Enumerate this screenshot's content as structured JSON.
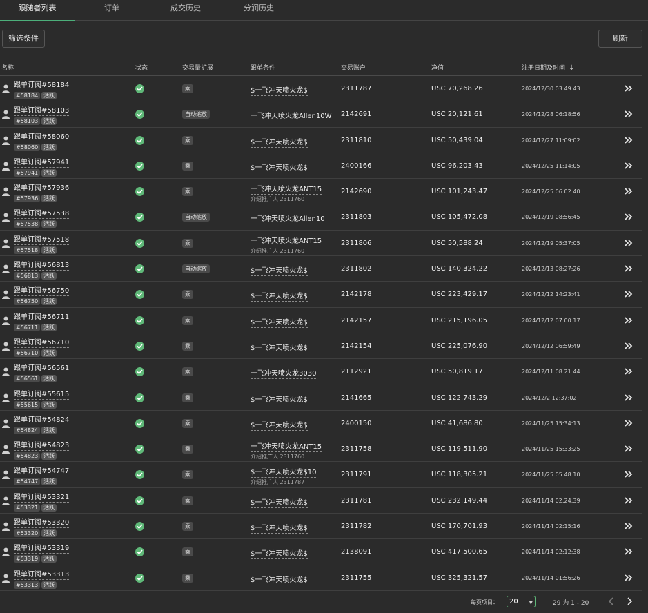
{
  "tabs": [
    {
      "label": "跟随者列表",
      "active": true
    },
    {
      "label": "订单",
      "active": false
    },
    {
      "label": "成交历史",
      "active": false
    },
    {
      "label": "分润历史",
      "active": false
    }
  ],
  "toolbar": {
    "filter_label": "筛选条件",
    "refresh_label": "刷新"
  },
  "columns": {
    "name": "名称",
    "status": "状态",
    "volume_scale": "交易量扩展",
    "copy_condition": "跟单条件",
    "account": "交易账户",
    "equity": "净值",
    "register_time": "注册日期及时间",
    "sort_icon": "arrow-down-icon"
  },
  "colors": {
    "accent": "#4caf7a",
    "status_ok": "#5fb878"
  },
  "rows": [
    {
      "name": "跟单订阅#58184",
      "id": "#58184",
      "badge": "活跃",
      "scale": "乘",
      "cond": "$一飞冲天喷火龙$",
      "sub": "",
      "account": "2311787",
      "equity": "USC 70,268.26",
      "date": "2024/12/30 03:49:43"
    },
    {
      "name": "跟单订阅#58103",
      "id": "#58103",
      "badge": "活跃",
      "scale": "自动缩放",
      "cond": "一飞冲天喷火龙Allen10W",
      "sub": "",
      "account": "2142691",
      "equity": "USC 20,121.61",
      "date": "2024/12/28 06:18:56"
    },
    {
      "name": "跟单订阅#58060",
      "id": "#58060",
      "badge": "活跃",
      "scale": "乘",
      "cond": "$一飞冲天喷火龙$",
      "sub": "",
      "account": "2311810",
      "equity": "USC 50,439.04",
      "date": "2024/12/27 11:09:02"
    },
    {
      "name": "跟单订阅#57941",
      "id": "#57941",
      "badge": "活跃",
      "scale": "乘",
      "cond": "$一飞冲天喷火龙$",
      "sub": "",
      "account": "2400166",
      "equity": "USC 96,203.43",
      "date": "2024/12/25 11:14:05"
    },
    {
      "name": "跟单订阅#57936",
      "id": "#57936",
      "badge": "活跃",
      "scale": "乘",
      "cond": "一飞冲天喷火龙ANT15",
      "sub": "介绍推广人 2311760",
      "account": "2142690",
      "equity": "USC 101,243.47",
      "date": "2024/12/25 06:02:40"
    },
    {
      "name": "跟单订阅#57538",
      "id": "#57538",
      "badge": "活跃",
      "scale": "自动缩放",
      "cond": "一飞冲天喷火龙Allen10",
      "sub": "",
      "account": "2311803",
      "equity": "USC 105,472.08",
      "date": "2024/12/19 08:56:45"
    },
    {
      "name": "跟单订阅#57518",
      "id": "#57518",
      "badge": "活跃",
      "scale": "乘",
      "cond": "一飞冲天喷火龙ANT15",
      "sub": "介绍推广人 2311760",
      "account": "2311806",
      "equity": "USC 50,588.24",
      "date": "2024/12/19 05:37:05"
    },
    {
      "name": "跟单订阅#56813",
      "id": "#56813",
      "badge": "活跃",
      "scale": "自动缩放",
      "cond": "$一飞冲天喷火龙$",
      "sub": "",
      "account": "2311802",
      "equity": "USC 140,324.22",
      "date": "2024/12/13 08:27:26"
    },
    {
      "name": "跟单订阅#56750",
      "id": "#56750",
      "badge": "活跃",
      "scale": "乘",
      "cond": "$一飞冲天喷火龙$",
      "sub": "",
      "account": "2142178",
      "equity": "USC 223,429.17",
      "date": "2024/12/12 14:23:41"
    },
    {
      "name": "跟单订阅#56711",
      "id": "#56711",
      "badge": "活跃",
      "scale": "乘",
      "cond": "$一飞冲天喷火龙$",
      "sub": "",
      "account": "2142157",
      "equity": "USC 215,196.05",
      "date": "2024/12/12 07:00:17"
    },
    {
      "name": "跟单订阅#56710",
      "id": "#56710",
      "badge": "活跃",
      "scale": "乘",
      "cond": "$一飞冲天喷火龙$",
      "sub": "",
      "account": "2142154",
      "equity": "USC 225,076.90",
      "date": "2024/12/12 06:59:49"
    },
    {
      "name": "跟单订阅#56561",
      "id": "#56561",
      "badge": "活跃",
      "scale": "乘",
      "cond": "一飞冲天喷火龙3030",
      "sub": "",
      "account": "2112921",
      "equity": "USC 50,819.17",
      "date": "2024/12/11 08:21:44"
    },
    {
      "name": "跟单订阅#55615",
      "id": "#55615",
      "badge": "活跃",
      "scale": "乘",
      "cond": "$一飞冲天喷火龙$",
      "sub": "",
      "account": "2141665",
      "equity": "USC 122,743.29",
      "date": "2024/12/2 12:37:02"
    },
    {
      "name": "跟单订阅#54824",
      "id": "#54824",
      "badge": "活跃",
      "scale": "乘",
      "cond": "$一飞冲天喷火龙$",
      "sub": "",
      "account": "2400150",
      "equity": "USC 41,686.80",
      "date": "2024/11/25 15:34:13"
    },
    {
      "name": "跟单订阅#54823",
      "id": "#54823",
      "badge": "活跃",
      "scale": "乘",
      "cond": "一飞冲天喷火龙ANT15",
      "sub": "介绍推广人 2311760",
      "account": "2311758",
      "equity": "USC 119,511.90",
      "date": "2024/11/25 15:33:25"
    },
    {
      "name": "跟单订阅#54747",
      "id": "#54747",
      "badge": "活跃",
      "scale": "乘",
      "cond": "$一飞冲天喷火龙$10",
      "sub": "介绍推广人 2311787",
      "account": "2311791",
      "equity": "USC 118,305.21",
      "date": "2024/11/25 05:48:10"
    },
    {
      "name": "跟单订阅#53321",
      "id": "#53321",
      "badge": "活跃",
      "scale": "乘",
      "cond": "$一飞冲天喷火龙$",
      "sub": "",
      "account": "2311781",
      "equity": "USC 232,149.44",
      "date": "2024/11/14 02:24:39"
    },
    {
      "name": "跟单订阅#53320",
      "id": "#53320",
      "badge": "活跃",
      "scale": "乘",
      "cond": "$一飞冲天喷火龙$",
      "sub": "",
      "account": "2311782",
      "equity": "USC 170,701.93",
      "date": "2024/11/14 02:15:16"
    },
    {
      "name": "跟单订阅#53319",
      "id": "#53319",
      "badge": "活跃",
      "scale": "乘",
      "cond": "$一飞冲天喷火龙$",
      "sub": "",
      "account": "2138091",
      "equity": "USC 417,500.65",
      "date": "2024/11/14 02:12:38"
    },
    {
      "name": "跟单订阅#53313",
      "id": "#53313",
      "badge": "活跃",
      "scale": "乘",
      "cond": "$一飞冲天喷火龙$",
      "sub": "",
      "account": "2311755",
      "equity": "USC 325,321.57",
      "date": "2024/11/14 01:56:26"
    }
  ],
  "footer": {
    "per_page_label": "每页项目：",
    "per_page_value": "20",
    "range_text": "29 为 1 - 20",
    "prev_icon": "chevron-left-icon",
    "next_icon": "chevron-right-icon"
  }
}
